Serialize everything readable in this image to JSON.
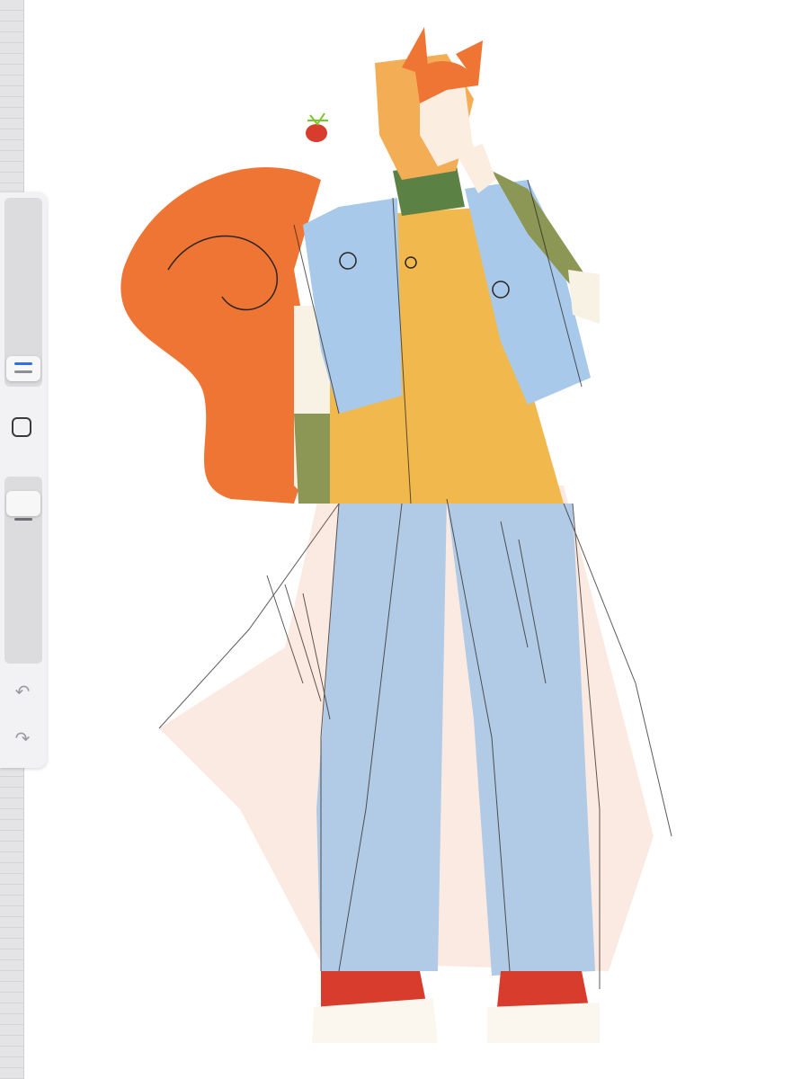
{
  "app": {
    "accent_color": "#2f6fed",
    "toolbar_color": "#f2f2f4"
  },
  "sidebar": {
    "brush_size_label": "",
    "opacity_label": "",
    "modify_icon": "square-icon",
    "undo_icon": "undo-icon",
    "redo_icon": "redo-icon",
    "undo_glyph": "↶",
    "redo_glyph": "↷"
  },
  "canvas": {
    "artwork": "squirrel-character-sketch"
  }
}
